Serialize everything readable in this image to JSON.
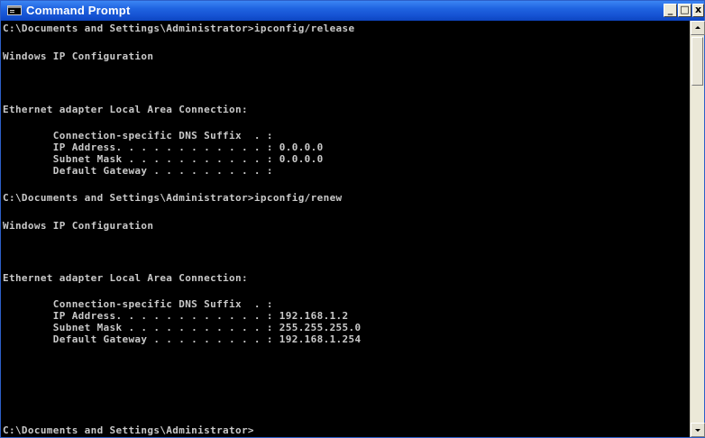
{
  "window": {
    "title": "Command Prompt",
    "controls": {
      "minimize": "_",
      "maximize": "□",
      "close": "x"
    }
  },
  "console": {
    "lines": [
      "C:\\Documents and Settings\\Administrator>ipconfig/release",
      "Windows IP Configuration",
      "Ethernet adapter Local Area Connection:",
      "        Connection-specific DNS Suffix  . :",
      "        IP Address. . . . . . . . . . . . : 0.0.0.0",
      "        Subnet Mask . . . . . . . . . . . : 0.0.0.0",
      "        Default Gateway . . . . . . . . . :",
      "C:\\Documents and Settings\\Administrator>ipconfig/renew",
      "Windows IP Configuration",
      "Ethernet adapter Local Area Connection:",
      "        Connection-specific DNS Suffix  . :",
      "        IP Address. . . . . . . . . . . . : 192.168.1.2",
      "        Subnet Mask . . . . . . . . . . . : 255.255.255.0",
      "        Default Gateway . . . . . . . . . : 192.168.1.254",
      "C:\\Documents and Settings\\Administrator>"
    ]
  },
  "colors": {
    "titlebar": "#1f63e0",
    "console_bg": "#000000",
    "console_text": "#c9c9c9"
  },
  "icons": {
    "window_icon": "cmd-window-icon",
    "scroll_up": "arrow-up-icon",
    "scroll_down": "arrow-down-icon"
  }
}
